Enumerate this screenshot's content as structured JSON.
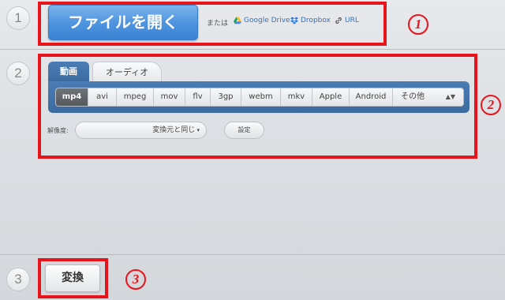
{
  "steps": {
    "one": "1",
    "two": "2",
    "three": "3"
  },
  "step1": {
    "open_file_label": "ファイルを開く",
    "or_label": "または",
    "sources": [
      {
        "label": "Google Drive",
        "icon": "google-drive-icon"
      },
      {
        "label": "Dropbox",
        "icon": "dropbox-icon"
      },
      {
        "label": "URL",
        "icon": "link-icon"
      }
    ]
  },
  "step2": {
    "tabs": [
      {
        "label": "動画",
        "active": true
      },
      {
        "label": "オーディオ",
        "active": false
      }
    ],
    "formats": [
      {
        "label": "mp4",
        "active": true
      },
      {
        "label": "avi"
      },
      {
        "label": "mpeg"
      },
      {
        "label": "mov"
      },
      {
        "label": "flv"
      },
      {
        "label": "3gp"
      },
      {
        "label": "webm"
      },
      {
        "label": "mkv"
      },
      {
        "label": "Apple"
      },
      {
        "label": "Android"
      },
      {
        "label": "その他"
      }
    ],
    "resolution_label": "解像度:",
    "resolution_value": "変換元と同じ",
    "settings_label": "設定"
  },
  "step3": {
    "convert_label": "変換"
  },
  "annotations": {
    "one": "1",
    "two": "2",
    "three": "3"
  },
  "colors": {
    "accent_blue": "#4f95e0",
    "panel_blue": "#3a6aa0",
    "annotation_red": "#e8141c"
  }
}
